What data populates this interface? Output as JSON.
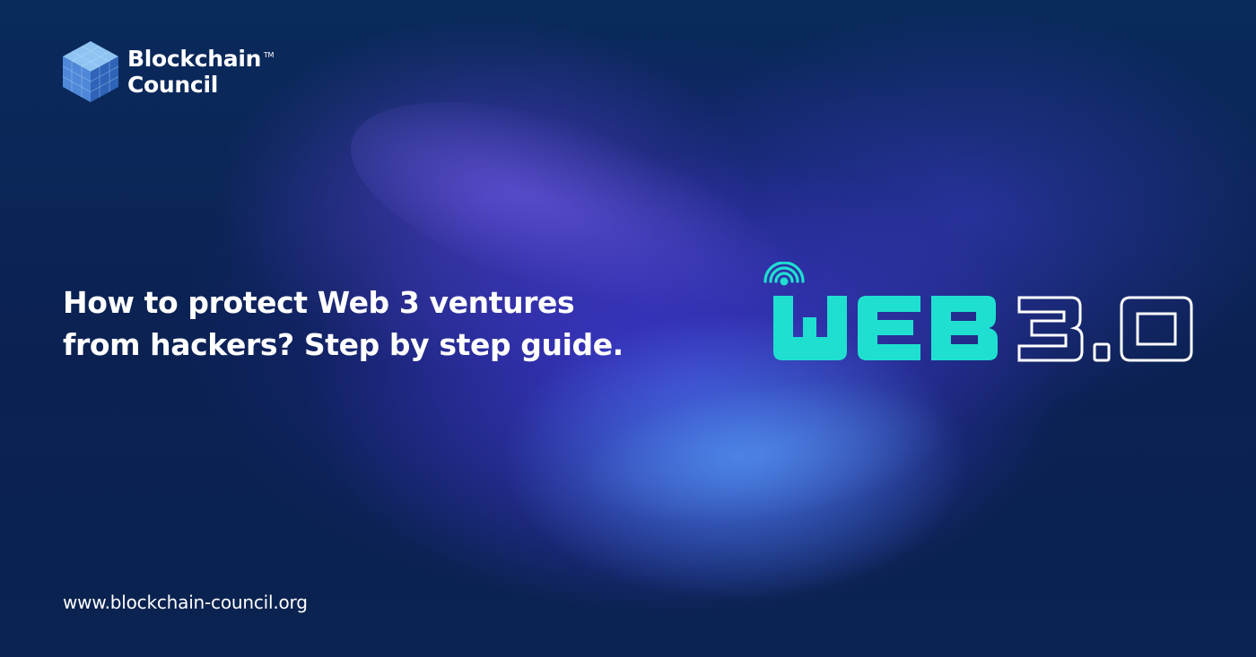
{
  "brand": {
    "name_line1": "Blockchain",
    "name_line2": "Council",
    "trademark": "TM",
    "logo_icon": "cube-icon"
  },
  "headline": {
    "line1": "How to protect Web 3 ventures",
    "line2": "from hackers? Step by step guide."
  },
  "graphic": {
    "text": "WEB 3.0",
    "icon": "wifi-signal-icon",
    "accent_color": "#1fe0d0",
    "outline_color": "#ffffff"
  },
  "footer": {
    "url": "www.blockchain-council.org"
  },
  "colors": {
    "background": "#0a2455",
    "glow": "#4a4ad8"
  }
}
